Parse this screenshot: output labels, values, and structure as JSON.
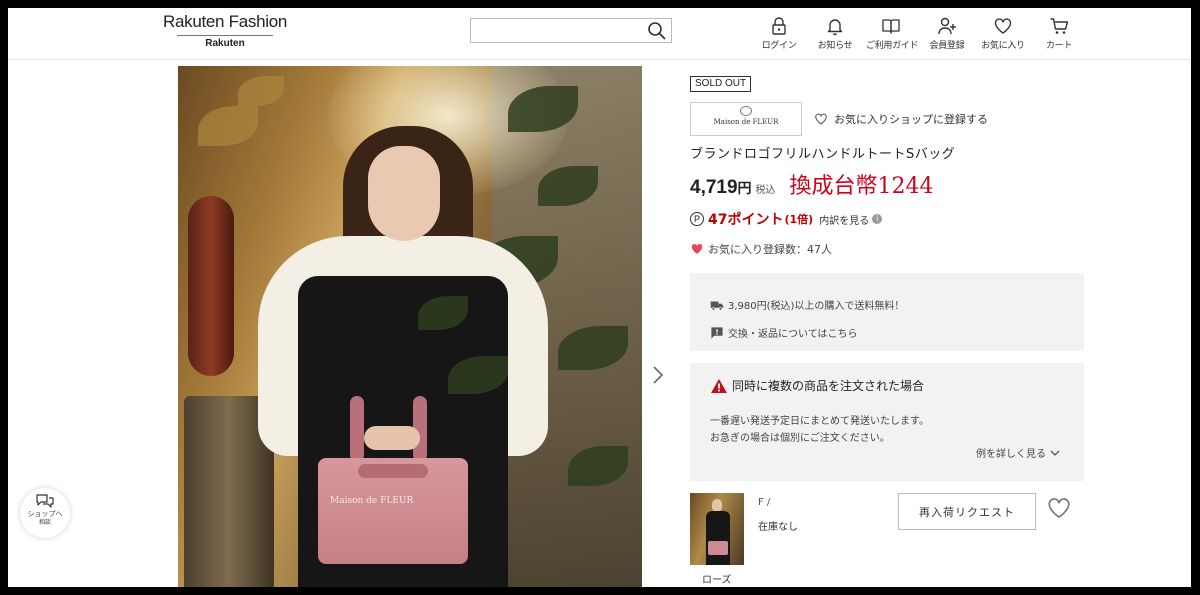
{
  "header": {
    "logo_main": "Rakuten Fashion",
    "logo_sub": "Rakuten",
    "search": {
      "placeholder": "",
      "value": ""
    },
    "nav": [
      {
        "label": "ログイン",
        "icon": "lock-icon"
      },
      {
        "label": "お知らせ",
        "icon": "bell-icon"
      },
      {
        "label": "ご利用ガイド",
        "icon": "book-icon"
      },
      {
        "label": "会員登録",
        "icon": "user-add-icon"
      },
      {
        "label": "お気に入り",
        "icon": "heart-icon"
      },
      {
        "label": "カート",
        "icon": "cart-icon"
      }
    ]
  },
  "product": {
    "sold_out": "SOLD OUT",
    "brand_logo_text": "Maison de FLEUR",
    "favorite_shop": "お気に入りショップに登録する",
    "title": "ブランドロゴフリルハンドルトートSバッグ",
    "price": "4,719",
    "price_unit": "円",
    "tax_label": "税込",
    "twd_price": "換成台幣1244",
    "points_icon": "P",
    "points": "47ポイント",
    "points_rate": "(1倍)",
    "points_detail": "内訳を見る",
    "favorites": "お気に入り登録数：47人",
    "image_bag_text": "Maison de FLEUR"
  },
  "shipping_box": {
    "free_shipping": "3,980円(税込)以上の購入で送料無料！",
    "returns": "交換・返品についてはこちら"
  },
  "multi_order_box": {
    "title": "同時に複数の商品を注文された場合",
    "line1": "一番遅い発送予定日にまとめて発送いたします。",
    "line2": "お急ぎの場合は個別にご注文ください。",
    "more": "例を詳しく見る"
  },
  "variant": {
    "color": "ローズ",
    "size": "F /",
    "stock": "在庫なし",
    "restock_button": "再入荷リクエスト"
  },
  "chat": {
    "line1": "ショップへ",
    "line2": "相談"
  },
  "colors": {
    "points_red": "#bf0000",
    "twd_red": "#d0021b",
    "heart_red": "#e8475a",
    "panel_bg": "#f2f2f2"
  }
}
